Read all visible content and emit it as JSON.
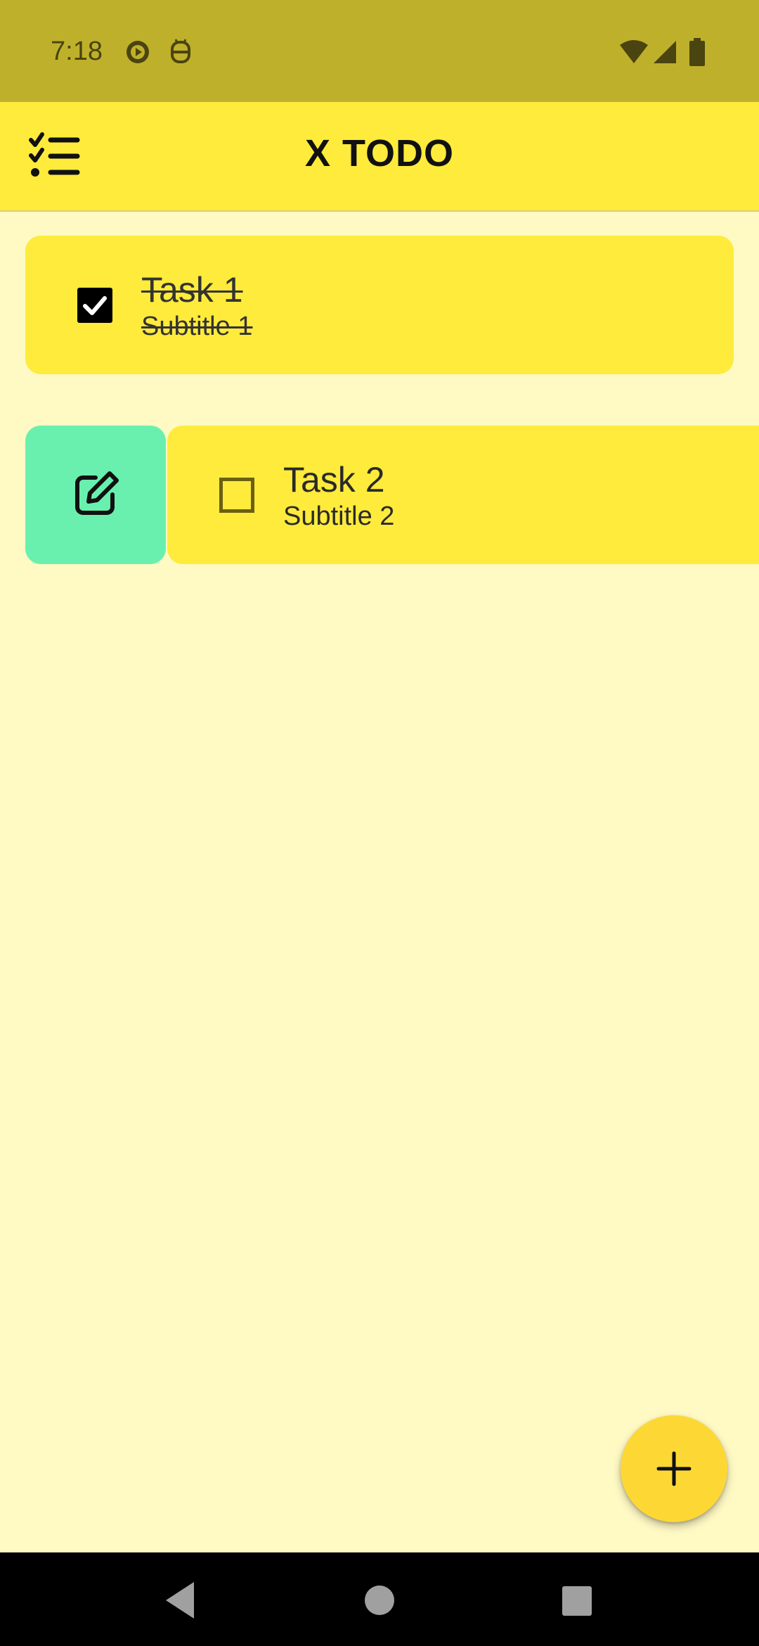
{
  "status_bar": {
    "time": "7:18",
    "icons": [
      "media-play-icon",
      "android-robot-icon",
      "wifi-icon",
      "cellular-signal-icon",
      "battery-icon"
    ]
  },
  "app_bar": {
    "title": "X TODO",
    "menu_icon": "checklist-icon"
  },
  "tasks": [
    {
      "title": "Task 1",
      "subtitle": "Subtitle 1",
      "completed": true
    },
    {
      "title": "Task 2",
      "subtitle": "Subtitle 2",
      "completed": false,
      "swipe_action": "edit-icon"
    }
  ],
  "fab": {
    "icon": "plus-icon"
  },
  "nav_bar": {
    "buttons": [
      "back-icon",
      "home-icon",
      "recents-icon"
    ]
  },
  "colors": {
    "status_bar": "#BFB02B",
    "app_bar": "#FFEB3B",
    "background": "#FFF9C4",
    "card": "#FFEB3B",
    "edit_action": "#69F0AE",
    "fab": "#FDD835"
  }
}
